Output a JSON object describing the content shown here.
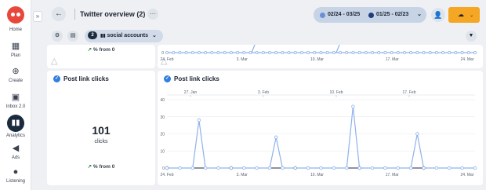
{
  "nav": {
    "items": [
      {
        "label": "Home",
        "icon": "owl-logo"
      },
      {
        "label": "Plan",
        "icon": "calendar-icon"
      },
      {
        "label": "Create",
        "icon": "plus-circle-icon"
      },
      {
        "label": "Inbox 2.0",
        "icon": "inbox-icon"
      },
      {
        "label": "Analytics",
        "icon": "bar-chart-icon"
      },
      {
        "label": "Ads",
        "icon": "megaphone-icon"
      },
      {
        "label": "Listening",
        "icon": "location-pin-icon"
      }
    ],
    "collapse_label": "»"
  },
  "header": {
    "back_label": "←",
    "title": "Twitter overview (2)",
    "more_label": "···",
    "date_range_1": "02/24 - 03/25",
    "date_range_1_color": "#6b8fd6",
    "date_range_2": "01/25 - 02/23",
    "date_range_2_color": "#1c3f7a",
    "download_label": "☁"
  },
  "toolbar": {
    "account_count": "2",
    "social_label": "social accounts"
  },
  "cards": {
    "top_left_change": "% from 0",
    "top_chart_ticks": [
      "24. Feb",
      "3. Mar",
      "10. Mar",
      "17. Mar",
      "24. Mar"
    ],
    "left_title": "Post link clicks",
    "left_value": "101",
    "left_unit": "clicks",
    "left_change": "% from 0",
    "chart_title": "Post link clicks"
  },
  "chart_data": {
    "type": "line",
    "title": "Post link clicks",
    "xlabel": "",
    "ylabel": "",
    "ylim": [
      0,
      40
    ],
    "yticks": [
      0,
      10,
      20,
      30,
      40
    ],
    "x_ticks_primary": [
      "24. Feb",
      "3. Mar",
      "10. Mar",
      "17. Mar",
      "24. Mar"
    ],
    "x_ticks_comparison": [
      "27. Jan",
      "3. Feb",
      "10. Feb",
      "17. Feb"
    ],
    "grid": true,
    "series": [
      {
        "color": "#8fb2ea",
        "values": [
          0,
          0,
          0,
          0,
          0,
          28,
          0,
          0,
          0,
          0,
          0,
          0,
          0,
          0,
          0,
          0,
          0,
          18,
          0,
          0,
          0,
          0,
          0,
          0,
          0,
          0,
          0,
          0,
          0,
          36,
          0,
          0,
          0,
          0,
          0,
          0,
          0,
          0,
          0,
          20,
          0,
          0,
          0,
          0,
          0,
          0,
          0,
          0,
          0
        ]
      },
      {
        "color": "#1c2a3e",
        "values": [
          0,
          0,
          0,
          0,
          0,
          0,
          0,
          0,
          0,
          0,
          0,
          0,
          0,
          0,
          0,
          0,
          0,
          0,
          0,
          0,
          0,
          0,
          0,
          0,
          0,
          0,
          0,
          0,
          0,
          0,
          0,
          0,
          0,
          0,
          0,
          0,
          0,
          0,
          0,
          0,
          0,
          0,
          0,
          0,
          0,
          0,
          0,
          0,
          0
        ]
      }
    ]
  }
}
